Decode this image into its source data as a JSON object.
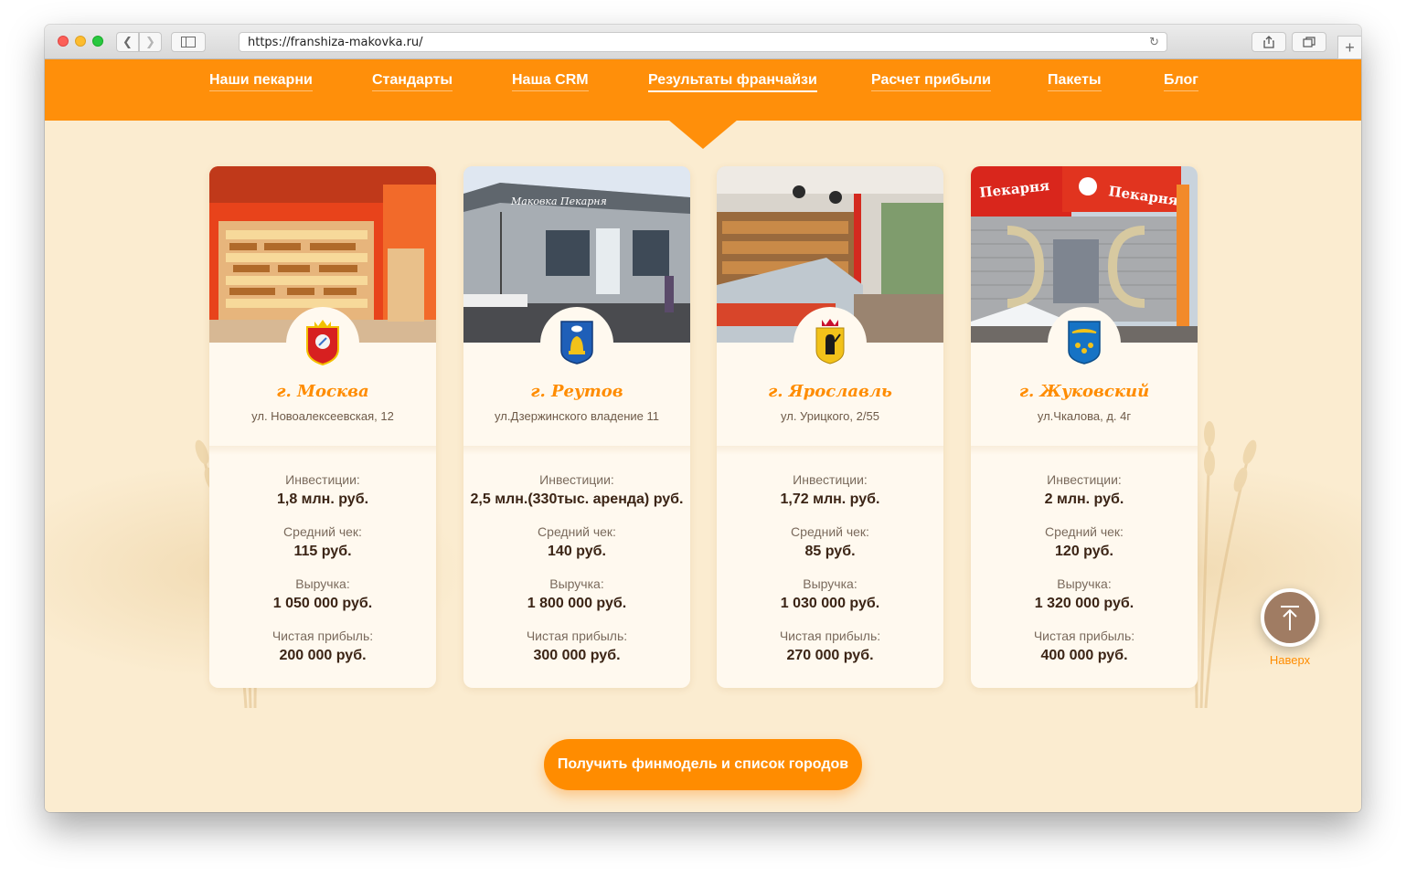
{
  "browser": {
    "url": "https://franshiza-makovka.ru/"
  },
  "nav": {
    "items": [
      {
        "label": "Наши пекарни"
      },
      {
        "label": "Стандарты"
      },
      {
        "label": "Наша CRM"
      },
      {
        "label": "Результаты франчайзи"
      },
      {
        "label": "Расчет прибыли"
      },
      {
        "label": "Пакеты"
      },
      {
        "label": "Блог"
      }
    ],
    "active_index": 3
  },
  "cards": [
    {
      "city": "г. Москва",
      "address": "ул. Новоалексеевская, 12",
      "stats": [
        {
          "label": "Инвестиции:",
          "value": "1,8 млн. руб."
        },
        {
          "label": "Средний чек:",
          "value": "115 руб."
        },
        {
          "label": "Выручка:",
          "value": "1 050 000 руб."
        },
        {
          "label": "Чистая прибыль:",
          "value": "200 000 руб."
        }
      ]
    },
    {
      "city": "г. Реутов",
      "address": "ул.Дзержинского владение 11",
      "photo_sign": "Маковка Пекарня",
      "stats": [
        {
          "label": "Инвестиции:",
          "value": "2,5 млн.(330тыс. аренда) руб."
        },
        {
          "label": "Средний чек:",
          "value": "140 руб."
        },
        {
          "label": "Выручка:",
          "value": "1 800 000 руб."
        },
        {
          "label": "Чистая прибыль:",
          "value": "300 000 руб."
        }
      ]
    },
    {
      "city": "г. Ярославль",
      "address": "ул. Урицкого, 2/55",
      "stats": [
        {
          "label": "Инвестиции:",
          "value": "1,72 млн. руб."
        },
        {
          "label": "Средний чек:",
          "value": "85 руб."
        },
        {
          "label": "Выручка:",
          "value": "1 030 000 руб."
        },
        {
          "label": "Чистая прибыль:",
          "value": "270 000 руб."
        }
      ]
    },
    {
      "city": "г. Жуковский",
      "address": "ул.Чкалова, д. 4г",
      "photo_sign": "Пекарня",
      "stats": [
        {
          "label": "Инвестиции:",
          "value": "2 млн. руб."
        },
        {
          "label": "Средний чек:",
          "value": "120 руб."
        },
        {
          "label": "Выручка:",
          "value": "1 320 000 руб."
        },
        {
          "label": "Чистая прибыль:",
          "value": "400 000 руб."
        }
      ]
    }
  ],
  "cta": {
    "label": "Получить финмодель и список городов"
  },
  "to_top": {
    "label": "Наверх",
    "icon": "arrow-up-to-line-icon"
  },
  "colors": {
    "accent": "#ff8c00",
    "nav_bg": "#ff8f0a",
    "page_bg": "#fbecd0",
    "heading": "#3b2415"
  }
}
